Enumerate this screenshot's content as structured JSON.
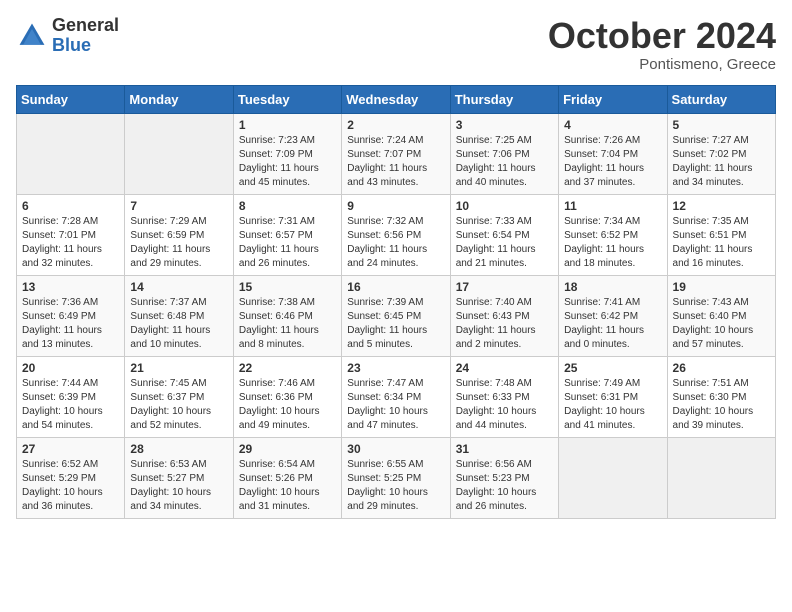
{
  "header": {
    "logo_general": "General",
    "logo_blue": "Blue",
    "month_title": "October 2024",
    "location": "Pontismeno, Greece"
  },
  "days_of_week": [
    "Sunday",
    "Monday",
    "Tuesday",
    "Wednesday",
    "Thursday",
    "Friday",
    "Saturday"
  ],
  "weeks": [
    [
      {
        "day": "",
        "sunrise": "",
        "sunset": "",
        "daylight": "",
        "empty": true
      },
      {
        "day": "",
        "sunrise": "",
        "sunset": "",
        "daylight": "",
        "empty": true
      },
      {
        "day": "1",
        "sunrise": "Sunrise: 7:23 AM",
        "sunset": "Sunset: 7:09 PM",
        "daylight": "Daylight: 11 hours and 45 minutes."
      },
      {
        "day": "2",
        "sunrise": "Sunrise: 7:24 AM",
        "sunset": "Sunset: 7:07 PM",
        "daylight": "Daylight: 11 hours and 43 minutes."
      },
      {
        "day": "3",
        "sunrise": "Sunrise: 7:25 AM",
        "sunset": "Sunset: 7:06 PM",
        "daylight": "Daylight: 11 hours and 40 minutes."
      },
      {
        "day": "4",
        "sunrise": "Sunrise: 7:26 AM",
        "sunset": "Sunset: 7:04 PM",
        "daylight": "Daylight: 11 hours and 37 minutes."
      },
      {
        "day": "5",
        "sunrise": "Sunrise: 7:27 AM",
        "sunset": "Sunset: 7:02 PM",
        "daylight": "Daylight: 11 hours and 34 minutes."
      }
    ],
    [
      {
        "day": "6",
        "sunrise": "Sunrise: 7:28 AM",
        "sunset": "Sunset: 7:01 PM",
        "daylight": "Daylight: 11 hours and 32 minutes."
      },
      {
        "day": "7",
        "sunrise": "Sunrise: 7:29 AM",
        "sunset": "Sunset: 6:59 PM",
        "daylight": "Daylight: 11 hours and 29 minutes."
      },
      {
        "day": "8",
        "sunrise": "Sunrise: 7:31 AM",
        "sunset": "Sunset: 6:57 PM",
        "daylight": "Daylight: 11 hours and 26 minutes."
      },
      {
        "day": "9",
        "sunrise": "Sunrise: 7:32 AM",
        "sunset": "Sunset: 6:56 PM",
        "daylight": "Daylight: 11 hours and 24 minutes."
      },
      {
        "day": "10",
        "sunrise": "Sunrise: 7:33 AM",
        "sunset": "Sunset: 6:54 PM",
        "daylight": "Daylight: 11 hours and 21 minutes."
      },
      {
        "day": "11",
        "sunrise": "Sunrise: 7:34 AM",
        "sunset": "Sunset: 6:52 PM",
        "daylight": "Daylight: 11 hours and 18 minutes."
      },
      {
        "day": "12",
        "sunrise": "Sunrise: 7:35 AM",
        "sunset": "Sunset: 6:51 PM",
        "daylight": "Daylight: 11 hours and 16 minutes."
      }
    ],
    [
      {
        "day": "13",
        "sunrise": "Sunrise: 7:36 AM",
        "sunset": "Sunset: 6:49 PM",
        "daylight": "Daylight: 11 hours and 13 minutes."
      },
      {
        "day": "14",
        "sunrise": "Sunrise: 7:37 AM",
        "sunset": "Sunset: 6:48 PM",
        "daylight": "Daylight: 11 hours and 10 minutes."
      },
      {
        "day": "15",
        "sunrise": "Sunrise: 7:38 AM",
        "sunset": "Sunset: 6:46 PM",
        "daylight": "Daylight: 11 hours and 8 minutes."
      },
      {
        "day": "16",
        "sunrise": "Sunrise: 7:39 AM",
        "sunset": "Sunset: 6:45 PM",
        "daylight": "Daylight: 11 hours and 5 minutes."
      },
      {
        "day": "17",
        "sunrise": "Sunrise: 7:40 AM",
        "sunset": "Sunset: 6:43 PM",
        "daylight": "Daylight: 11 hours and 2 minutes."
      },
      {
        "day": "18",
        "sunrise": "Sunrise: 7:41 AM",
        "sunset": "Sunset: 6:42 PM",
        "daylight": "Daylight: 11 hours and 0 minutes."
      },
      {
        "day": "19",
        "sunrise": "Sunrise: 7:43 AM",
        "sunset": "Sunset: 6:40 PM",
        "daylight": "Daylight: 10 hours and 57 minutes."
      }
    ],
    [
      {
        "day": "20",
        "sunrise": "Sunrise: 7:44 AM",
        "sunset": "Sunset: 6:39 PM",
        "daylight": "Daylight: 10 hours and 54 minutes."
      },
      {
        "day": "21",
        "sunrise": "Sunrise: 7:45 AM",
        "sunset": "Sunset: 6:37 PM",
        "daylight": "Daylight: 10 hours and 52 minutes."
      },
      {
        "day": "22",
        "sunrise": "Sunrise: 7:46 AM",
        "sunset": "Sunset: 6:36 PM",
        "daylight": "Daylight: 10 hours and 49 minutes."
      },
      {
        "day": "23",
        "sunrise": "Sunrise: 7:47 AM",
        "sunset": "Sunset: 6:34 PM",
        "daylight": "Daylight: 10 hours and 47 minutes."
      },
      {
        "day": "24",
        "sunrise": "Sunrise: 7:48 AM",
        "sunset": "Sunset: 6:33 PM",
        "daylight": "Daylight: 10 hours and 44 minutes."
      },
      {
        "day": "25",
        "sunrise": "Sunrise: 7:49 AM",
        "sunset": "Sunset: 6:31 PM",
        "daylight": "Daylight: 10 hours and 41 minutes."
      },
      {
        "day": "26",
        "sunrise": "Sunrise: 7:51 AM",
        "sunset": "Sunset: 6:30 PM",
        "daylight": "Daylight: 10 hours and 39 minutes."
      }
    ],
    [
      {
        "day": "27",
        "sunrise": "Sunrise: 6:52 AM",
        "sunset": "Sunset: 5:29 PM",
        "daylight": "Daylight: 10 hours and 36 minutes."
      },
      {
        "day": "28",
        "sunrise": "Sunrise: 6:53 AM",
        "sunset": "Sunset: 5:27 PM",
        "daylight": "Daylight: 10 hours and 34 minutes."
      },
      {
        "day": "29",
        "sunrise": "Sunrise: 6:54 AM",
        "sunset": "Sunset: 5:26 PM",
        "daylight": "Daylight: 10 hours and 31 minutes."
      },
      {
        "day": "30",
        "sunrise": "Sunrise: 6:55 AM",
        "sunset": "Sunset: 5:25 PM",
        "daylight": "Daylight: 10 hours and 29 minutes."
      },
      {
        "day": "31",
        "sunrise": "Sunrise: 6:56 AM",
        "sunset": "Sunset: 5:23 PM",
        "daylight": "Daylight: 10 hours and 26 minutes."
      },
      {
        "day": "",
        "sunrise": "",
        "sunset": "",
        "daylight": "",
        "empty": true
      },
      {
        "day": "",
        "sunrise": "",
        "sunset": "",
        "daylight": "",
        "empty": true
      }
    ]
  ]
}
